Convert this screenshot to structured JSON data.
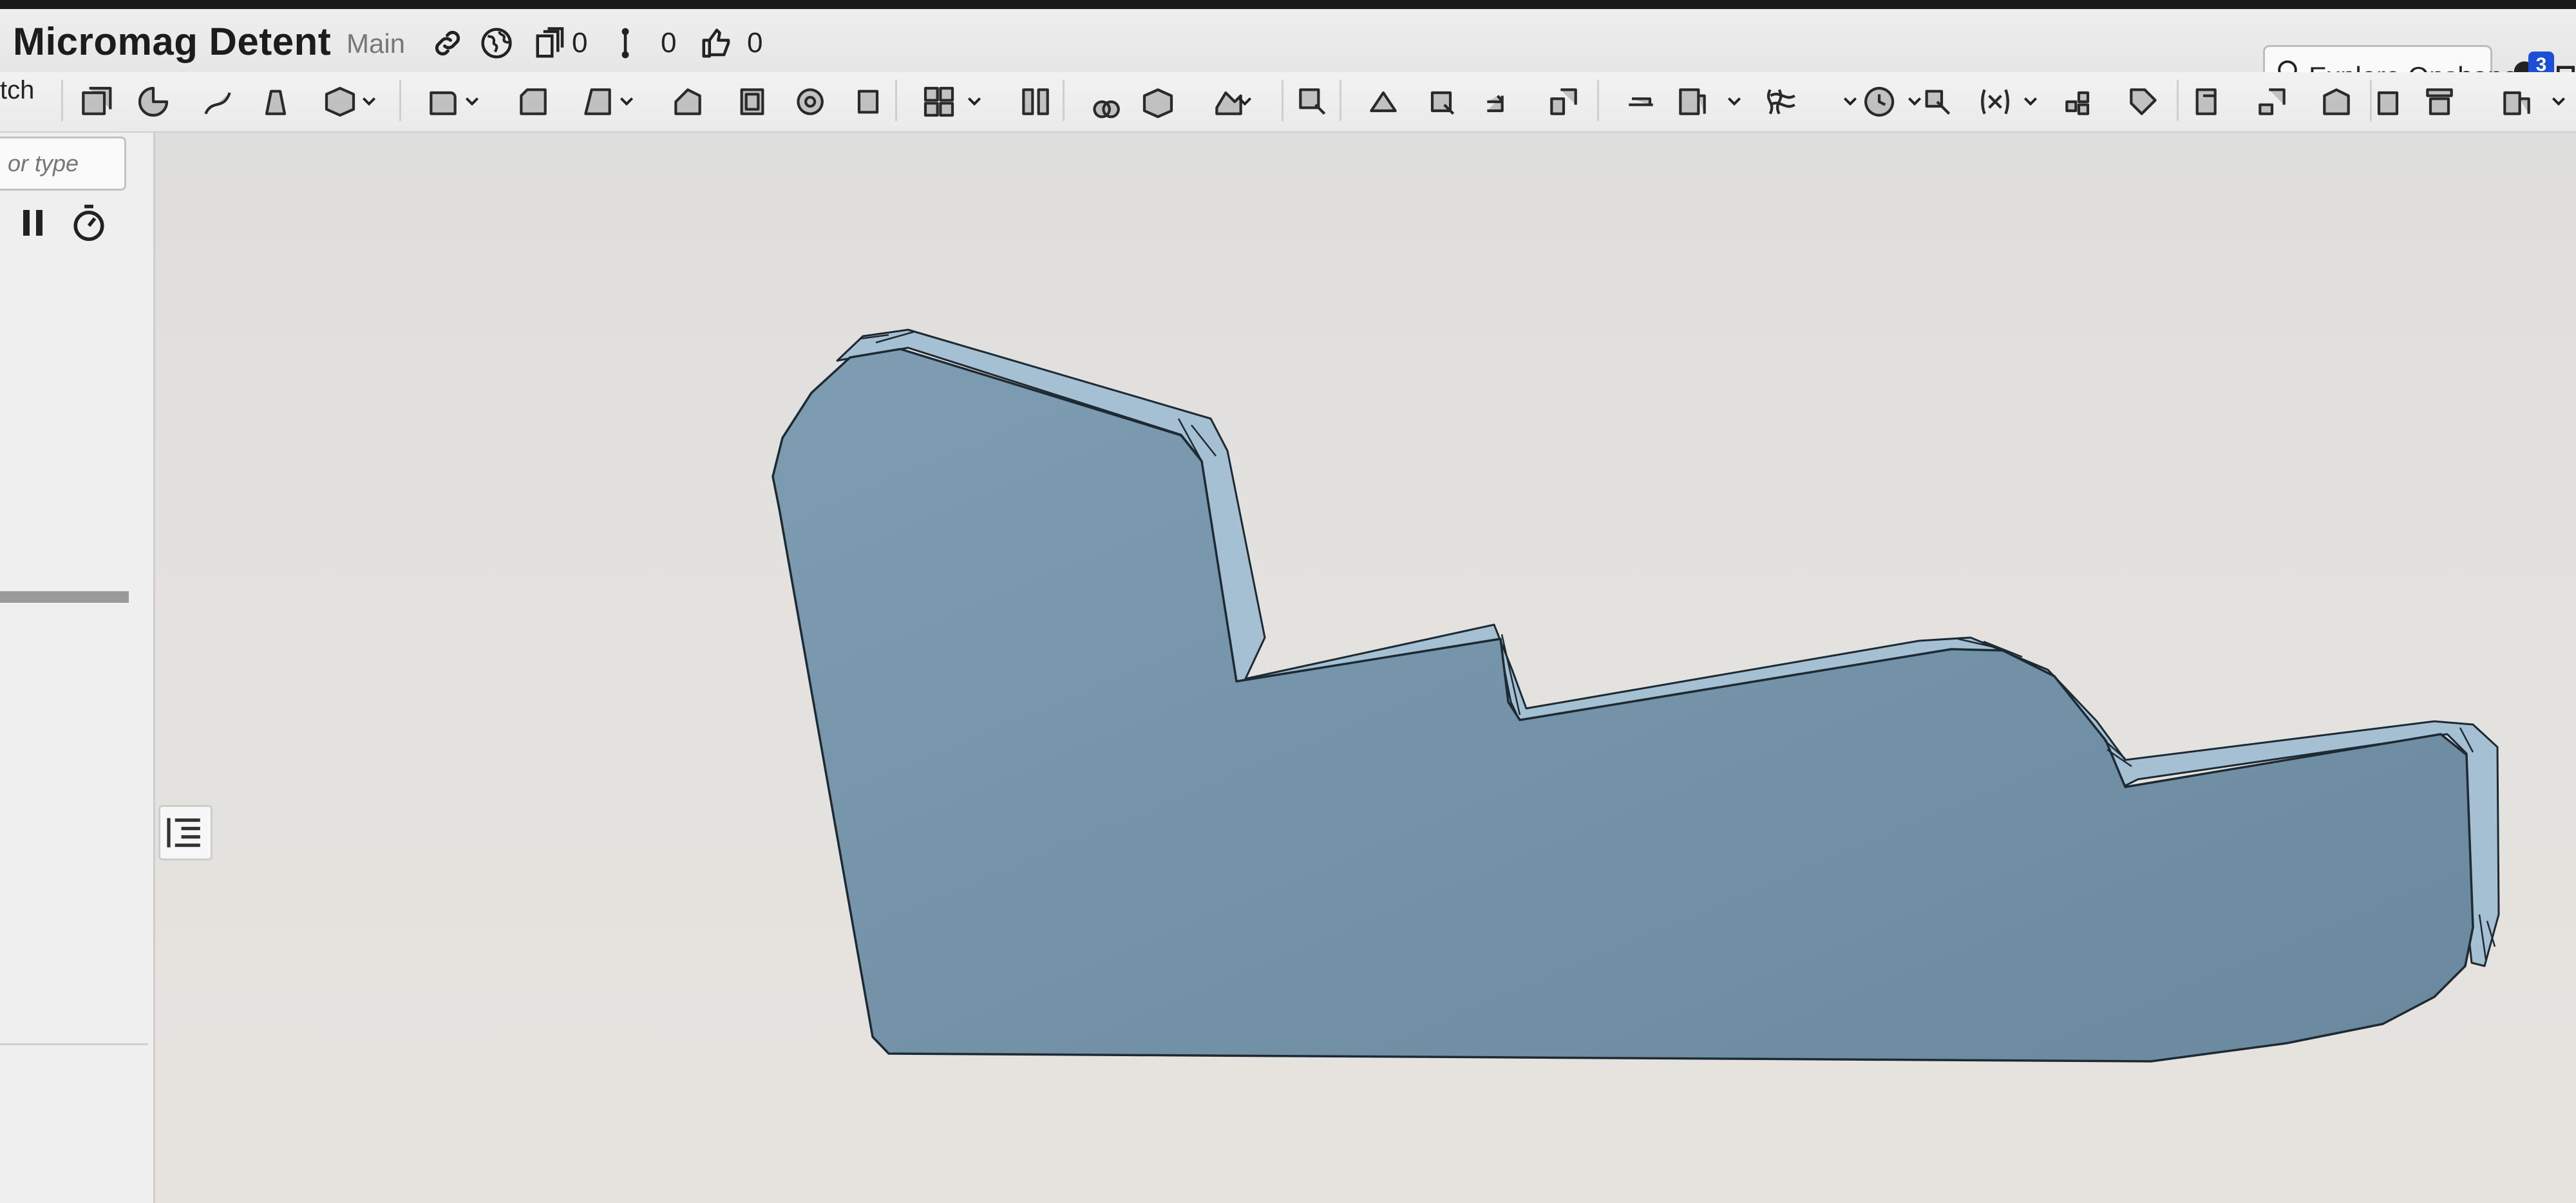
{
  "document": {
    "title": "Micromag Detent",
    "branch": "Main"
  },
  "header": {
    "link_icon": "link-icon",
    "globe_icon": "globe-icon",
    "versions_icon": "versions-icon",
    "versions_count": "0",
    "branches_icon": "branches-icon",
    "branches_count": "0",
    "likes_icon": "thumbs-up-icon",
    "likes_count": "0",
    "explore_label": "Explore Onshape",
    "notifications_count": "3"
  },
  "toolbar": {
    "partial_label": "tch",
    "icons": [
      "extrude-icon",
      "revolve-icon",
      "sweep-icon",
      "loft-icon",
      "thicken-icon",
      "fillet-icon",
      "chamfer-icon",
      "draft-icon",
      "rib-icon",
      "shell-icon",
      "hole-icon",
      "cylinder-icon",
      "pattern-icon",
      "mirror-icon",
      "boolean-icon",
      "split-icon",
      "transform-icon",
      "delete-part-icon",
      "modify-fillet-icon",
      "delete-face-icon",
      "move-face-icon",
      "replace-face-icon",
      "offset-surface-icon",
      "plane-icon",
      "helix-icon",
      "curves-icon",
      "measure-icon",
      "mate-connector-icon",
      "variable-icon",
      "variable-studio-icon",
      "tag-icon",
      "sheet-metal-icon",
      "sheet-metal-remove-icon",
      "flange-icon",
      "tab-icon",
      "form-icon",
      "finish-icon"
    ]
  },
  "left_panel": {
    "filter_placeholder": "or type",
    "pause_icon": "pause-icon",
    "timer_icon": "stopwatch-icon",
    "list_icon": "feature-list-icon"
  },
  "viewport": {
    "part": "detent-part-body",
    "colors": {
      "face": "#7d9cb1",
      "face_dark": "#6c8aa0",
      "edge": "#a9c4d6",
      "outline": "#1e2a33"
    }
  }
}
